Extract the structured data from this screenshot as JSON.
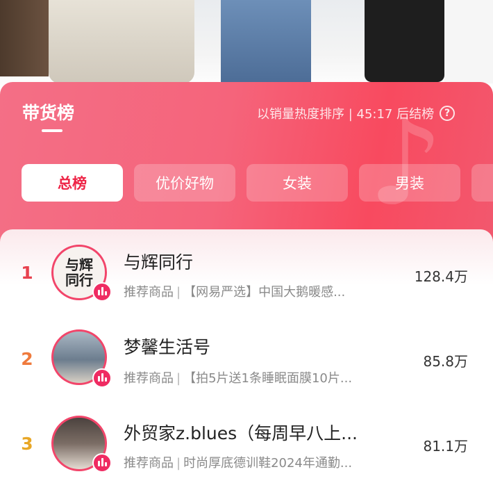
{
  "header": {
    "title": "带货榜",
    "subtitle": "以销量热度排序 | 45:17 后结榜",
    "help_icon": "question-circle-icon"
  },
  "tabs": [
    {
      "label": "总榜",
      "active": true
    },
    {
      "label": "优价好物",
      "active": false
    },
    {
      "label": "女装",
      "active": false
    },
    {
      "label": "男装",
      "active": false
    }
  ],
  "ranking": [
    {
      "rank": "1",
      "name": "与辉同行",
      "tag": "推荐商品",
      "product": "【网易严选】中国大鹅暖感...",
      "value": "128.4万",
      "avatar_text": "与辉同行"
    },
    {
      "rank": "2",
      "name": "梦馨生活号",
      "tag": "推荐商品",
      "product": "【拍5片送1条睡眠面膜10片...",
      "value": "85.8万"
    },
    {
      "rank": "3",
      "name": "外贸家z.blues（每周早八上...",
      "tag": "推荐商品",
      "product": "时尚厚底德训鞋2024年通勤...",
      "value": "81.1万"
    }
  ],
  "colors": {
    "accent": "#ee2446",
    "panel": "#f5647b",
    "rank1": "#e8424f",
    "rank2": "#ef7a3c",
    "rank3": "#e8a727"
  }
}
